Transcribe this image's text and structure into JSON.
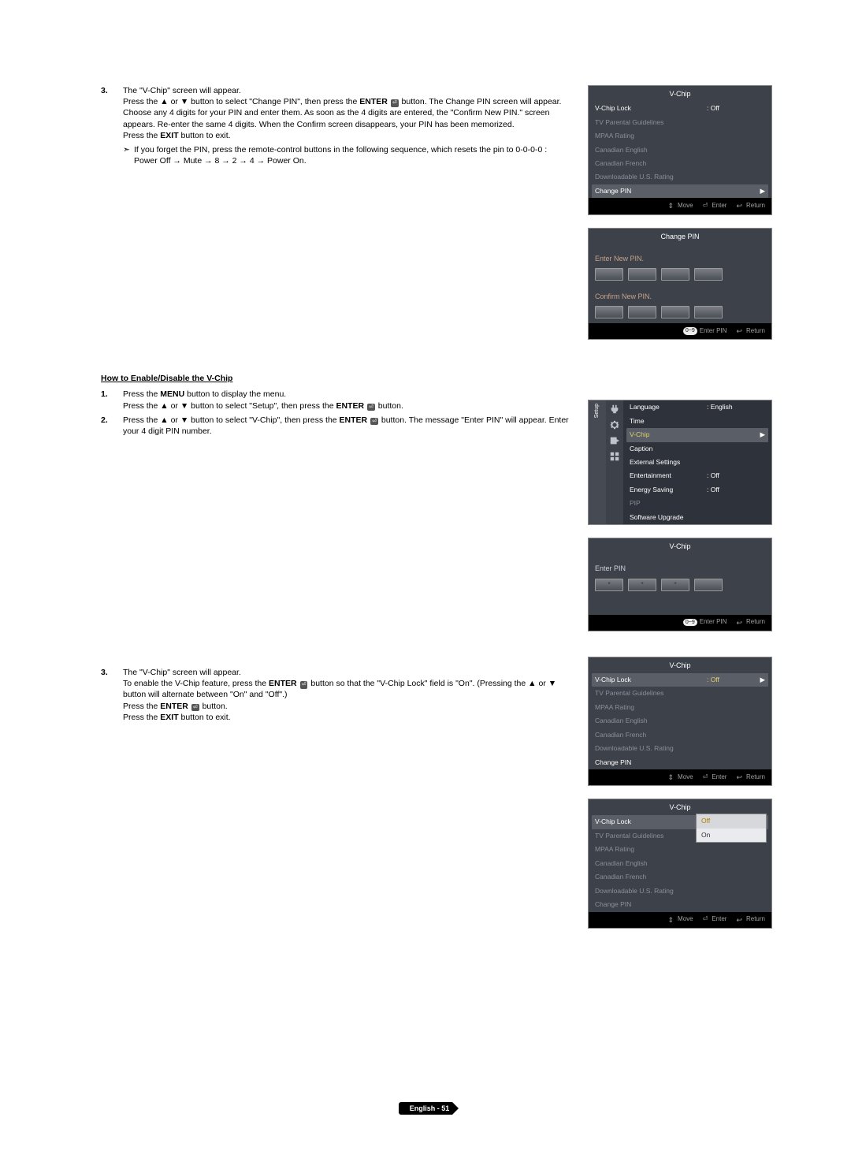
{
  "section1": {
    "step3_num": "3.",
    "step3_text_a": "The \"V-Chip\" screen will appear.",
    "step3_text_b1": "Press the ▲ or ▼ button to select \"Change PIN\", then press the ",
    "step3_text_b_bold": "ENTER",
    "step3_text_b2": " button. The Change PIN screen will appear. Choose any 4 digits for your PIN and enter them. As soon as the 4 digits are entered, the \"Confirm New PIN.\" screen appears. Re-enter the same 4 digits. When the Confirm screen disappears, your PIN has been memorized.",
    "step3_exit1": "Press the ",
    "step3_exit_bold": "EXIT",
    "step3_exit2": " button to exit.",
    "note_bullet": "➣",
    "note_text": "If you forget the PIN, press the remote-control buttons in the following sequence, which resets the pin to 0-0-0-0 : Power Off → Mute → 8 → 2 → 4 → Power On."
  },
  "section2": {
    "heading": "How to Enable/Disable the V-Chip",
    "s1_num": "1.",
    "s1_a1": "Press the ",
    "s1_a_bold": "MENU",
    "s1_a2": " button to display the menu.",
    "s1_b1": "Press the ▲ or ▼ button to select \"Setup\", then press the ",
    "s1_b_bold": "ENTER",
    "s1_b2": " button.",
    "s2_num": "2.",
    "s2_a1": "Press the ▲ or ▼ button to select \"V-Chip\", then press the ",
    "s2_a_bold": "ENTER",
    "s2_a2": " button. The message \"Enter PIN\" will appear. Enter your 4 digit PIN number.",
    "s3_num": "3.",
    "s3_a": "The \"V-Chip\" screen will appear.",
    "s3_b1": "To enable the V-Chip feature, press the ",
    "s3_b_bold": "ENTER",
    "s3_b2": " button so that the \"V-Chip Lock\" field is \"On\". (Pressing the ▲ or ▼ button will alternate between \"On\" and \"Off\".)",
    "s3_c1": "Press the ",
    "s3_c_bold": "ENTER",
    "s3_c2": " button.",
    "s3_d1": "Press the ",
    "s3_d_bold": "EXIT",
    "s3_d2": " button to exit."
  },
  "osd_vchip": {
    "title": "V-Chip",
    "items": [
      {
        "label": "V-Chip Lock",
        "val": ": Off",
        "dim": false
      },
      {
        "label": "TV Parental Guidelines",
        "val": "",
        "dim": true
      },
      {
        "label": "MPAA Rating",
        "val": "",
        "dim": true
      },
      {
        "label": "Canadian English",
        "val": "",
        "dim": true
      },
      {
        "label": "Canadian French",
        "val": "",
        "dim": true
      },
      {
        "label": "Downloadable U.S. Rating",
        "val": "",
        "dim": true
      },
      {
        "label": "Change PIN",
        "val": "",
        "dim": false,
        "selected": true,
        "arrow": "▶"
      }
    ]
  },
  "osd_changepin": {
    "title": "Change PIN",
    "new_label": "Enter New PIN.",
    "confirm_label": "Confirm New PIN."
  },
  "osd_setup": {
    "side": "Setup",
    "items": [
      {
        "label": "Language",
        "val": ": English"
      },
      {
        "label": "Time",
        "val": ""
      },
      {
        "label": "V-Chip",
        "val": "",
        "selected": true,
        "arrow": "▶",
        "yellow": true
      },
      {
        "label": "Caption",
        "val": ""
      },
      {
        "label": "External Settings",
        "val": ""
      },
      {
        "label": "Entertainment",
        "val": ": Off"
      },
      {
        "label": "Energy Saving",
        "val": ": Off"
      },
      {
        "label": "PIP",
        "val": "",
        "dim": true
      },
      {
        "label": "Software Upgrade",
        "val": ""
      }
    ]
  },
  "osd_enterpin": {
    "title": "V-Chip",
    "label": "Enter PIN",
    "dots": [
      "*",
      "*",
      "*",
      ""
    ]
  },
  "osd_vchip2": {
    "title": "V-Chip",
    "items": [
      {
        "label": "V-Chip Lock",
        "val": ": Off",
        "selected": true,
        "arrow": "▶",
        "yellowval": true
      },
      {
        "label": "TV Parental Guidelines",
        "val": "",
        "dim": true
      },
      {
        "label": "MPAA Rating",
        "val": "",
        "dim": true
      },
      {
        "label": "Canadian English",
        "val": "",
        "dim": true
      },
      {
        "label": "Canadian French",
        "val": "",
        "dim": true
      },
      {
        "label": "Downloadable U.S. Rating",
        "val": "",
        "dim": true
      },
      {
        "label": "Change PIN",
        "val": "",
        "dim": false
      }
    ]
  },
  "osd_vchip3": {
    "title": "V-Chip",
    "items": [
      {
        "label": "V-Chip Lock",
        "val": "",
        "selected": true
      },
      {
        "label": "TV Parental Guidelines",
        "val": "",
        "dim": true
      },
      {
        "label": "MPAA Rating",
        "val": "",
        "dim": true
      },
      {
        "label": "Canadian English",
        "val": "",
        "dim": true
      },
      {
        "label": "Canadian French",
        "val": "",
        "dim": true
      },
      {
        "label": "Downloadable U.S. Rating",
        "val": "",
        "dim": true
      },
      {
        "label": "Change PIN",
        "val": "",
        "dim": true
      }
    ],
    "dropdown": [
      "Off",
      "On"
    ]
  },
  "footer": {
    "move": "Move",
    "enter": "Enter",
    "return": "Return",
    "enterpin": "Enter PIN",
    "badge": "0~9"
  },
  "page": "English - 51"
}
